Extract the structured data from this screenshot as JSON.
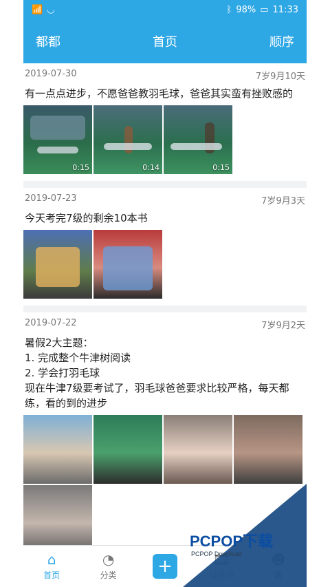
{
  "status_bar": {
    "signal": "ᵃˡˡ",
    "battery": "98%",
    "time": "11:33"
  },
  "header": {
    "left_button": "都都",
    "title": "首页",
    "right_button": "顺序"
  },
  "posts": [
    {
      "date": "2019-07-30",
      "age": "7岁9月10天",
      "text": "有一点点进步，不愿爸爸教羽毛球，爸爸其实蛮有挫败感的",
      "media": [
        {
          "duration": "0:15"
        },
        {
          "duration": "0:14"
        },
        {
          "duration": "0:15"
        }
      ]
    },
    {
      "date": "2019-07-23",
      "age": "7岁9月3天",
      "text": "今天考完7级的剩余10本书",
      "media": [
        {
          "duration": ""
        },
        {
          "duration": ""
        }
      ]
    },
    {
      "date": "2019-07-22",
      "age": "7岁9月2天",
      "text": "暑假2大主题：\n1. 完成整个牛津树阅读\n2. 学会打羽毛球\n现在牛津7级要考试了，羽毛球爸爸要求比较严格，每天都练，看的到的进步",
      "media": [
        {
          "duration": ""
        },
        {
          "duration": ""
        },
        {
          "duration": ""
        },
        {
          "duration": ""
        },
        {
          "duration": ""
        }
      ]
    }
  ],
  "tabbar": {
    "home": "首页",
    "category": "分类",
    "add": "+",
    "growth_book": "成长书",
    "me": "我"
  },
  "watermark": {
    "brand": "PCPOP下载",
    "sub": "PCPOP Download"
  },
  "colors": {
    "accent": "#2ea7e5",
    "watermark_blue": "#1f4f86"
  }
}
